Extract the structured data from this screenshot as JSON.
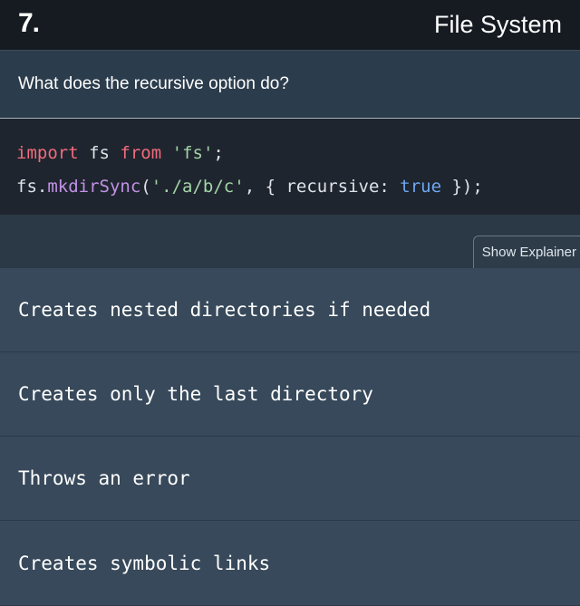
{
  "header": {
    "logo": "7.",
    "title": "File System"
  },
  "question": {
    "text": "What does the recursive option do?"
  },
  "code": {
    "line1": {
      "kw_import": "import",
      "ident_fs": " fs ",
      "kw_from": "from",
      "space": " ",
      "str_fs": "'fs'",
      "end": ";"
    },
    "line2": {
      "obj": "fs.",
      "fn": "mkdirSync",
      "open": "(",
      "str_path": "'./a/b/c'",
      "mid": ", { recursive: ",
      "bool": "true",
      "close": " });"
    }
  },
  "toolbar": {
    "explainer_label": "Show Explainer"
  },
  "answers": [
    {
      "label": "Creates nested directories if needed"
    },
    {
      "label": "Creates only the last directory"
    },
    {
      "label": "Throws an error"
    },
    {
      "label": "Creates symbolic links"
    }
  ]
}
